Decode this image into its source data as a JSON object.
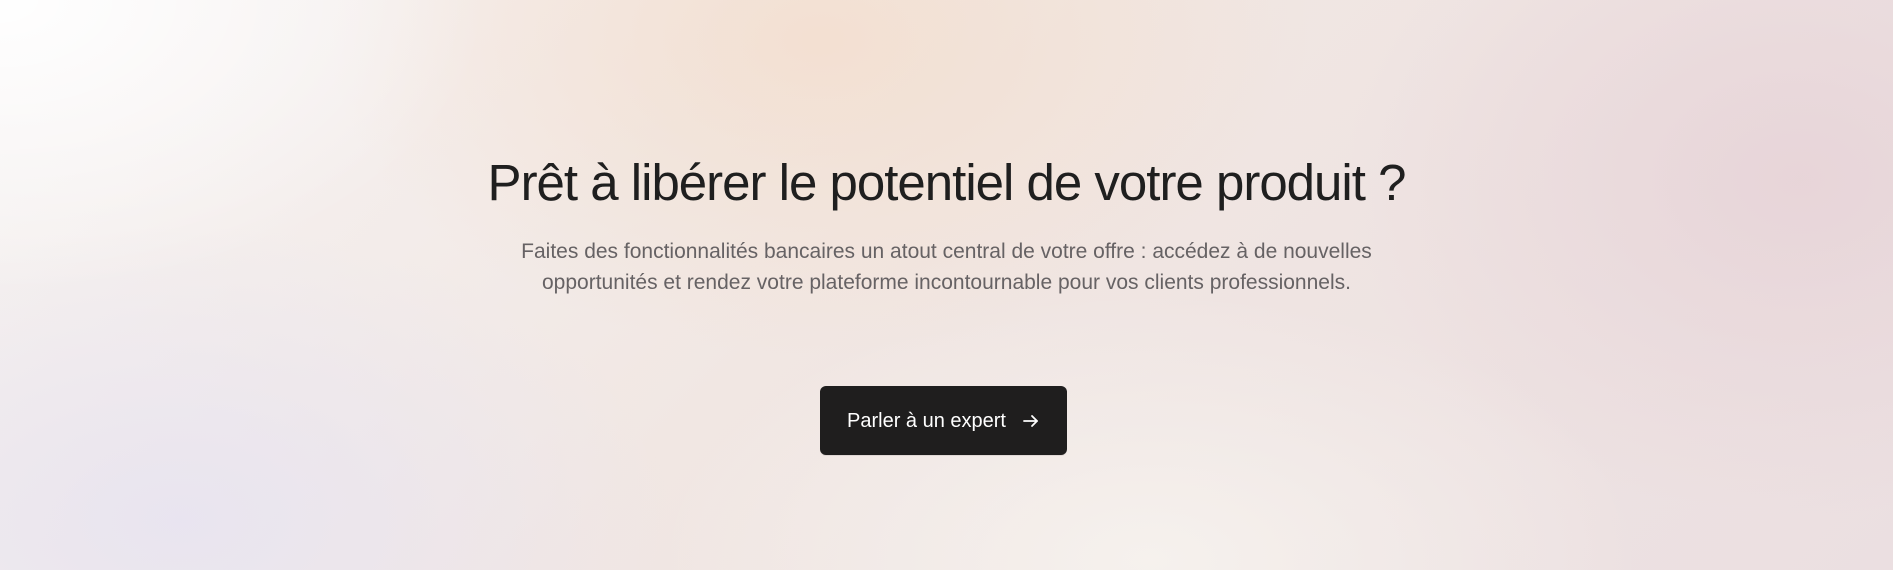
{
  "hero": {
    "title": "Prêt à libérer le potentiel de votre produit ?",
    "subtitle_line1": "Faites des fonctionnalités bancaires un atout central de votre offre : accédez à de nouvelles",
    "subtitle_line2": "opportunités et rendez votre plateforme incontournable pour vos clients professionnels.",
    "cta_label": "Parler à un expert",
    "cta_icon": "arrow-right-icon"
  },
  "colors": {
    "title": "#1f1f1f",
    "subtitle": "#666264",
    "button_background": "#1f1e1e",
    "button_text": "#ffffff"
  }
}
